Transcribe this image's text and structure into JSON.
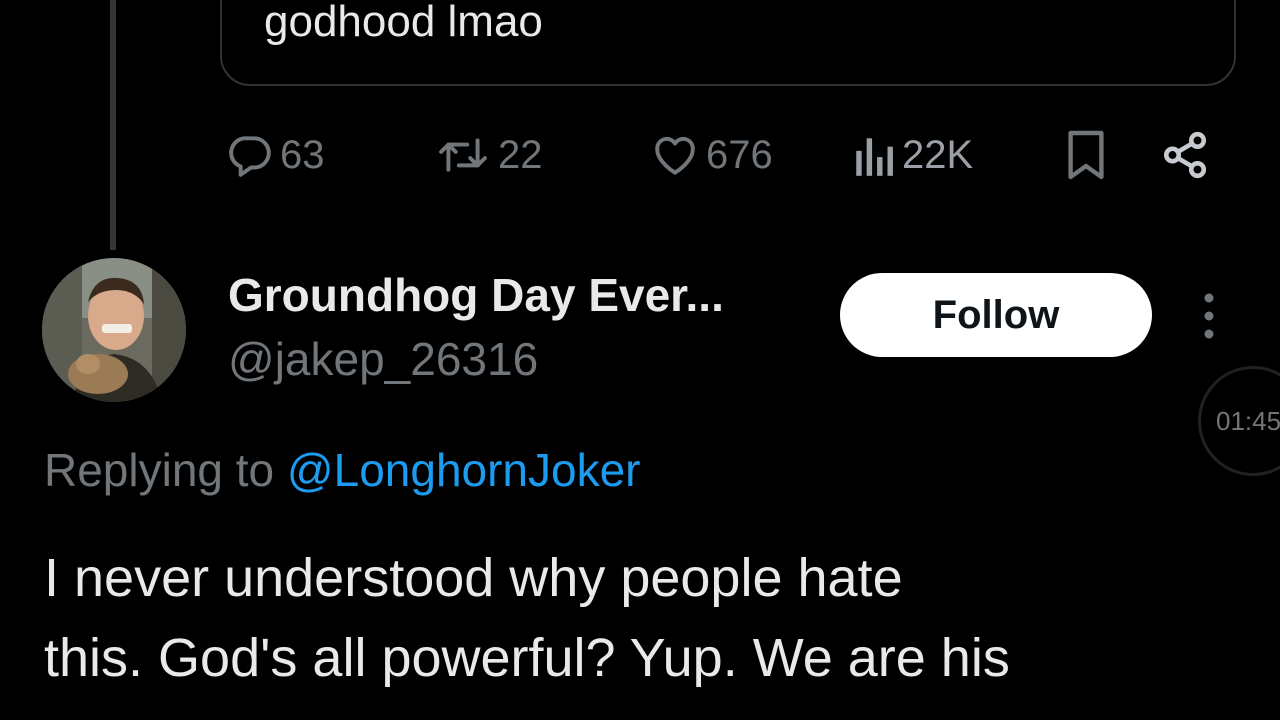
{
  "quoted_tweet": {
    "text": "godhood lmao"
  },
  "actions": {
    "reply": {
      "icon": "reply-icon",
      "count": "63"
    },
    "repost": {
      "icon": "repost-icon",
      "count": "22"
    },
    "like": {
      "icon": "heart-icon",
      "count": "676"
    },
    "views": {
      "icon": "views-chart-icon",
      "count": "22K"
    },
    "bookmark": {
      "icon": "bookmark-icon"
    },
    "share": {
      "icon": "share-icon"
    }
  },
  "reply_tweet": {
    "author": {
      "display_name": "Groundhog Day Ever...",
      "handle": "@jakep_26316"
    },
    "follow_label": "Follow",
    "replying_prefix": "Replying to ",
    "replying_mention": "@LonghornJoker",
    "body_lines": [
      "I never understood why people hate",
      "this.  God's all powerful? Yup.  We are his"
    ]
  },
  "video_timer": "01:45",
  "colors": {
    "background": "#000000",
    "text_primary": "#e7e9ea",
    "text_secondary": "#71767b",
    "accent_link": "#1d9bf0",
    "follow_button_bg": "#ffffff"
  }
}
